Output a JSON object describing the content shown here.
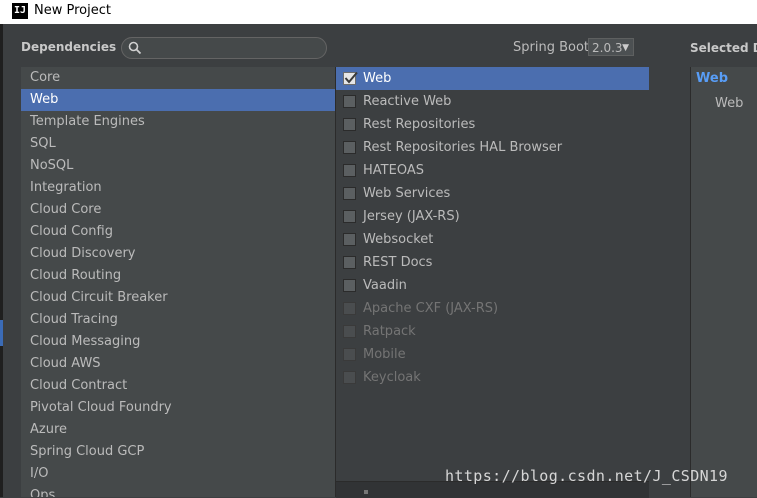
{
  "window": {
    "title": "New Project",
    "app_icon_text": "IJ"
  },
  "header": {
    "dependencies_label": "Dependencies",
    "search": {
      "value": "",
      "placeholder": ""
    },
    "spring_boot_label": "Spring Boot",
    "spring_boot_version": "2.0.3"
  },
  "categories": [
    {
      "label": "Core",
      "selected": false
    },
    {
      "label": "Web",
      "selected": true
    },
    {
      "label": "Template Engines",
      "selected": false
    },
    {
      "label": "SQL",
      "selected": false
    },
    {
      "label": "NoSQL",
      "selected": false
    },
    {
      "label": "Integration",
      "selected": false
    },
    {
      "label": "Cloud Core",
      "selected": false
    },
    {
      "label": "Cloud Config",
      "selected": false
    },
    {
      "label": "Cloud Discovery",
      "selected": false
    },
    {
      "label": "Cloud Routing",
      "selected": false
    },
    {
      "label": "Cloud Circuit Breaker",
      "selected": false
    },
    {
      "label": "Cloud Tracing",
      "selected": false
    },
    {
      "label": "Cloud Messaging",
      "selected": false
    },
    {
      "label": "Cloud AWS",
      "selected": false
    },
    {
      "label": "Cloud Contract",
      "selected": false
    },
    {
      "label": "Pivotal Cloud Foundry",
      "selected": false
    },
    {
      "label": "Azure",
      "selected": false
    },
    {
      "label": "Spring Cloud GCP",
      "selected": false
    },
    {
      "label": "I/O",
      "selected": false
    },
    {
      "label": "Ops",
      "selected": false
    }
  ],
  "dependencies": [
    {
      "label": "Web",
      "checked": true,
      "enabled": true
    },
    {
      "label": "Reactive Web",
      "checked": false,
      "enabled": true
    },
    {
      "label": "Rest Repositories",
      "checked": false,
      "enabled": true
    },
    {
      "label": "Rest Repositories HAL Browser",
      "checked": false,
      "enabled": true
    },
    {
      "label": "HATEOAS",
      "checked": false,
      "enabled": true
    },
    {
      "label": "Web Services",
      "checked": false,
      "enabled": true
    },
    {
      "label": "Jersey (JAX-RS)",
      "checked": false,
      "enabled": true
    },
    {
      "label": "Websocket",
      "checked": false,
      "enabled": true
    },
    {
      "label": "REST Docs",
      "checked": false,
      "enabled": true
    },
    {
      "label": "Vaadin",
      "checked": false,
      "enabled": true
    },
    {
      "label": "Apache CXF (JAX-RS)",
      "checked": false,
      "enabled": false
    },
    {
      "label": "Ratpack",
      "checked": false,
      "enabled": false
    },
    {
      "label": "Mobile",
      "checked": false,
      "enabled": false
    },
    {
      "label": "Keycloak",
      "checked": false,
      "enabled": false
    }
  ],
  "selected_panel": {
    "header": "Selected D",
    "group": "Web",
    "items": [
      "Web"
    ]
  },
  "watermark": "https://blog.csdn.net/J_CSDN19",
  "colors": {
    "background": "#3c3f41",
    "list_background": "#45494a",
    "selection": "#4b6eaf",
    "group_accent": "#589df6"
  },
  "icons": {
    "search": "magnifier-icon",
    "dropdown": "triangle-down-icon",
    "check": "checkmark-icon"
  }
}
